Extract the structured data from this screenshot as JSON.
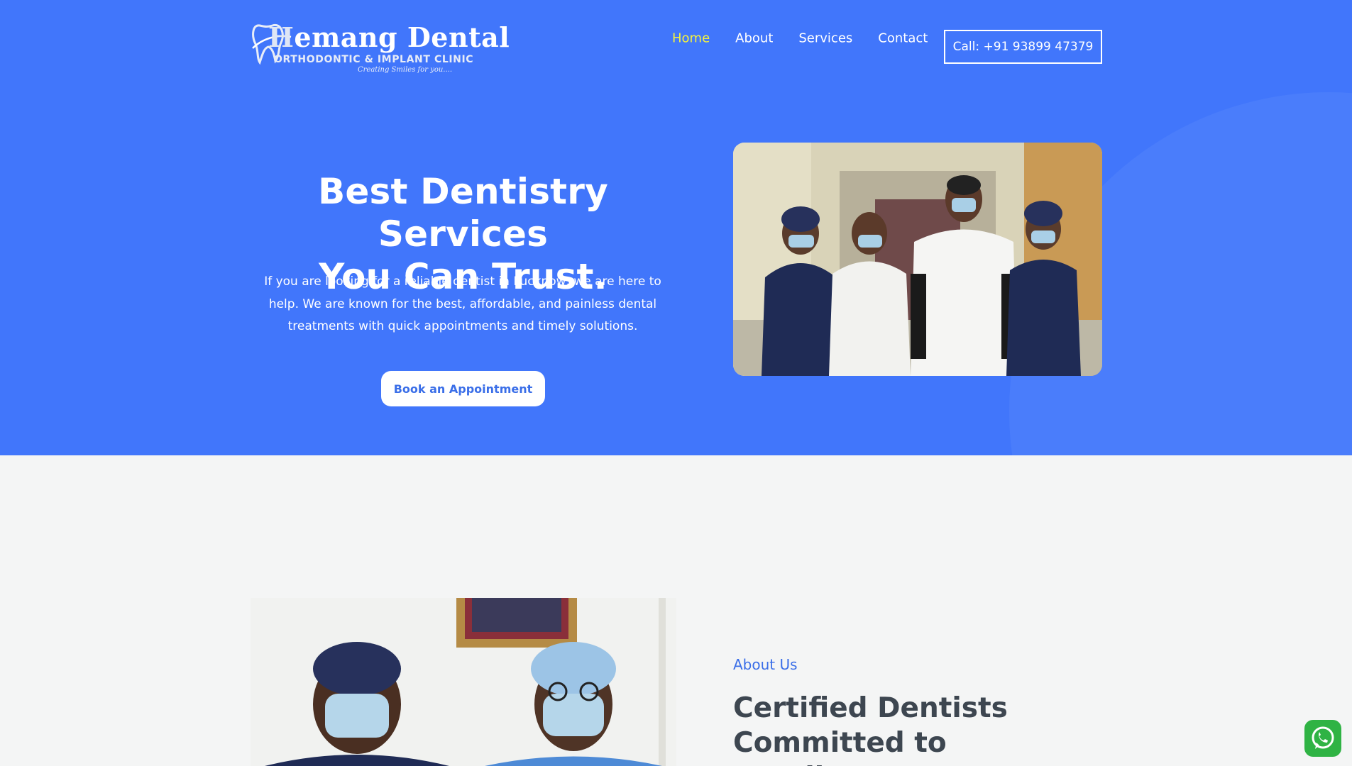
{
  "brand": {
    "name_initial": "H",
    "name_rest": "emang Dental",
    "subtitle": "ORTHODONTIC & IMPLANT CLINIC",
    "tagline": "Creating Smiles for you....",
    "logo_icon": "tooth-icon"
  },
  "nav": {
    "items": [
      {
        "label": "Home",
        "active": true
      },
      {
        "label": "About",
        "active": false
      },
      {
        "label": "Services",
        "active": false
      },
      {
        "label": "Contact",
        "active": false
      }
    ],
    "call_label": "Call: +91 93899 47379"
  },
  "hero": {
    "title_line1": "Best Dentistry Services",
    "title_line2": "You Can Trust.",
    "description": "If you are looking for a reliable dentist in Lucknow, we are here to help. We are known for the best, affordable, and painless dental treatments with quick appointments and timely solutions.",
    "cta_label": "Book an Appointment"
  },
  "about": {
    "label": "About Us",
    "title": "Certified Dentists Committed to Excellence"
  },
  "widgets": {
    "whatsapp_icon": "whatsapp-icon"
  },
  "colors": {
    "hero_blue": "#4176fb",
    "nav_active": "#f4f23d",
    "accent_blue": "#3a6ee8",
    "heading_dark": "#3d4650",
    "page_bg": "#f4f5f5",
    "whatsapp_green": "#2fb344"
  }
}
